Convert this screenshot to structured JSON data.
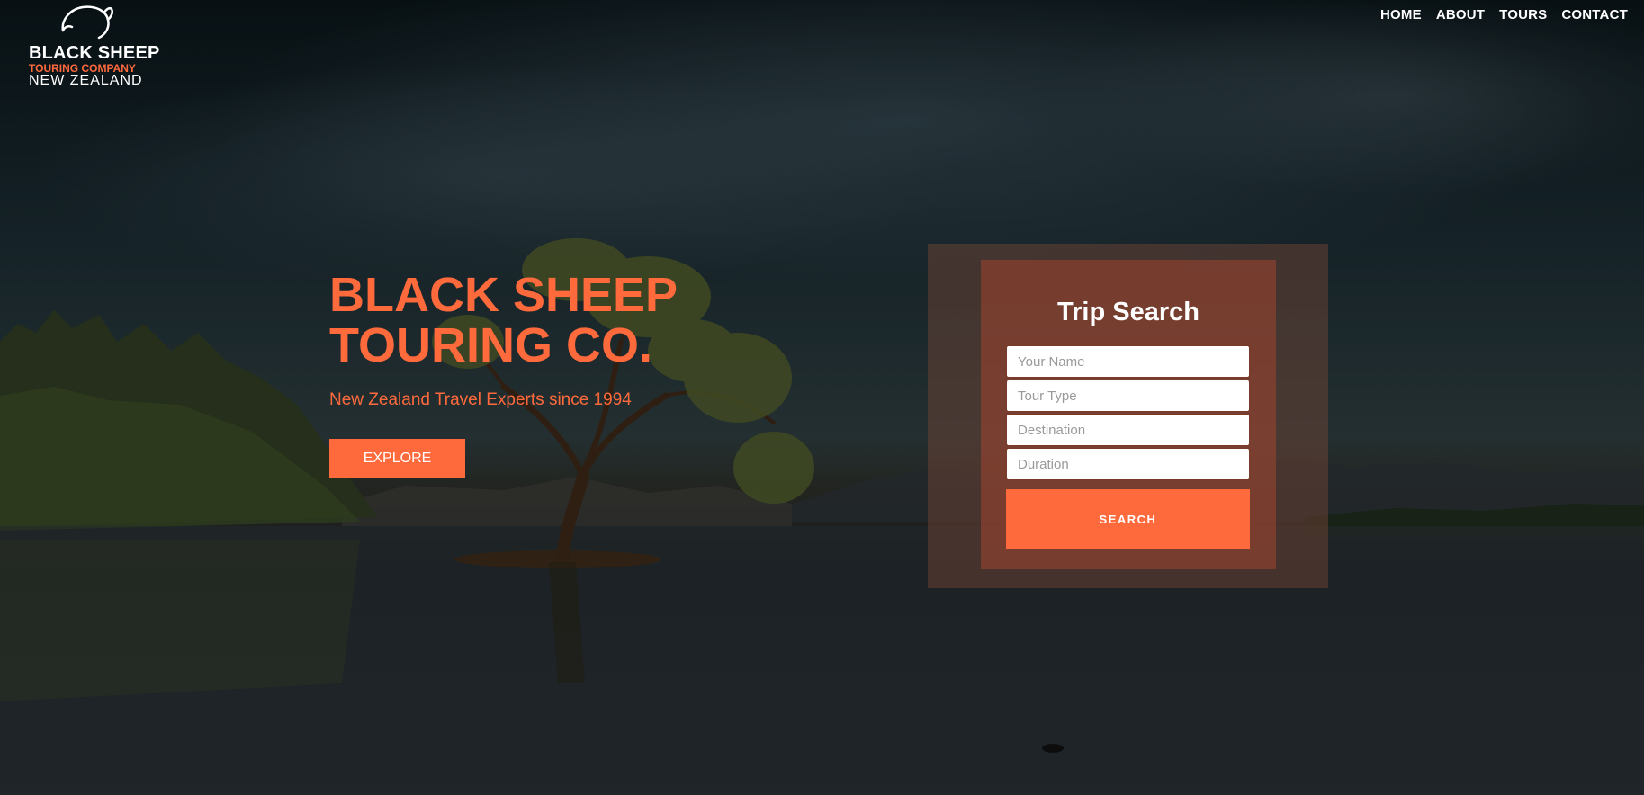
{
  "brand": {
    "line1": "BLACK SHEEP",
    "line2": "TOURING COMPANY",
    "line3": "NEW ZEALAND",
    "icon": "sheep-icon",
    "accent_color": "#ff6a3d"
  },
  "nav": {
    "items": [
      {
        "label": "HOME"
      },
      {
        "label": "ABOUT"
      },
      {
        "label": "TOURS"
      },
      {
        "label": "CONTACT"
      }
    ]
  },
  "hero": {
    "title": "BLACK SHEEP TOURING CO.",
    "subtitle": "New Zealand Travel Experts since 1994",
    "cta_label": "EXPLORE"
  },
  "search": {
    "title": "Trip Search",
    "fields": [
      {
        "placeholder": "Your Name",
        "value": ""
      },
      {
        "placeholder": "Tour Type",
        "value": ""
      },
      {
        "placeholder": "Destination",
        "value": ""
      },
      {
        "placeholder": "Duration",
        "value": ""
      }
    ],
    "button_label": "SEARCH"
  }
}
